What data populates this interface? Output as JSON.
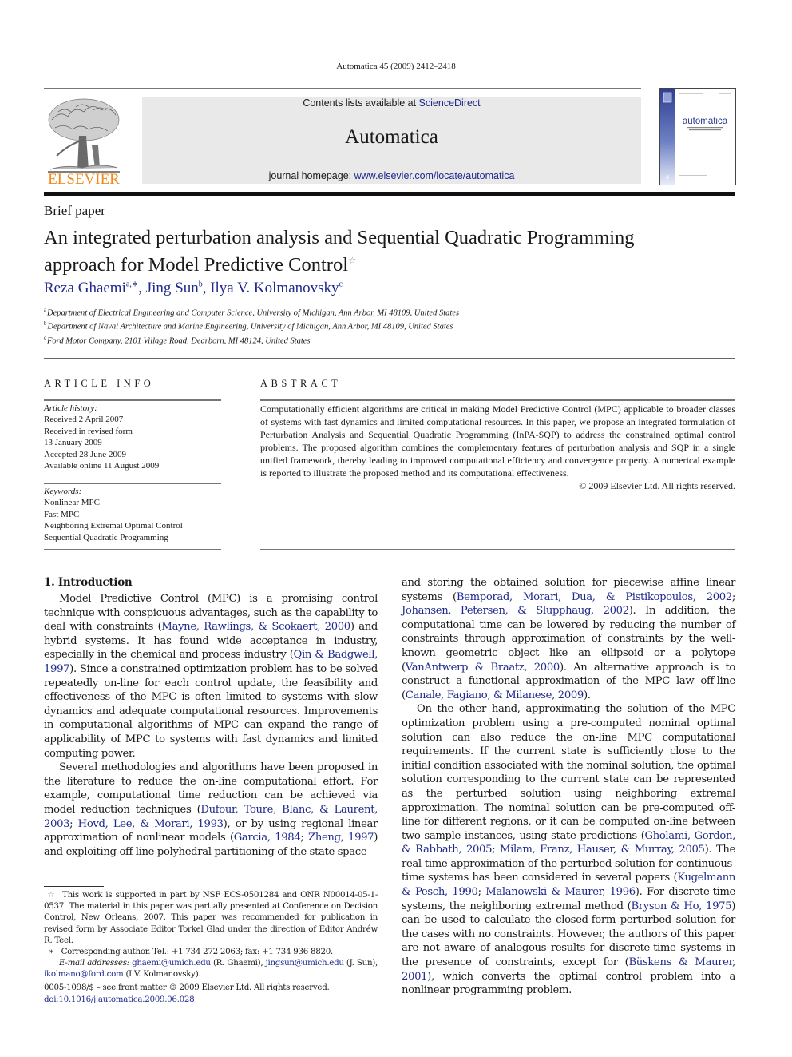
{
  "header": {
    "running_head": "Automatica 45 (2009) 2412–2418",
    "contents_prefix": "Contents lists available at ",
    "contents_link": "ScienceDirect",
    "journal_name": "Automatica",
    "homepage_prefix": "journal homepage: ",
    "homepage_link": "www.elsevier.com/locate/automatica",
    "publisher_logo_text": "ELSEVIER",
    "cover_title": "automatica",
    "colors": {
      "publisher_orange": "#f08a1c",
      "link_blue": "#1f2a8c",
      "masthead_gray": "#e9e9e9",
      "cover_blue": "#3a4fa0"
    }
  },
  "article": {
    "type": "Brief paper",
    "title_line1": "An integrated perturbation analysis and Sequential Quadratic Programming",
    "title_line2": "approach for Model Predictive Control",
    "title_mark": "☆",
    "authors": [
      {
        "name": "Reza Ghaemi",
        "sup": "a,∗"
      },
      {
        "name": "Jing Sun",
        "sup": "b"
      },
      {
        "name": "Ilya V. Kolmanovsky",
        "sup": "c"
      }
    ],
    "affiliations": [
      {
        "key": "a",
        "text": "Department of Electrical Engineering and Computer Science, University of Michigan, Ann Arbor, MI 48109, United States"
      },
      {
        "key": "b",
        "text": "Department of Naval Architecture and Marine Engineering, University of Michigan, Ann Arbor, MI 48109, United States"
      },
      {
        "key": "c",
        "text": "Ford Motor Company, 2101 Village Road, Dearborn, MI 48124, United States"
      }
    ]
  },
  "article_info": {
    "heading": "ARTICLE INFO",
    "history_label": "Article history:",
    "history": [
      "Received 2 April 2007",
      "Received in revised form",
      "13 January 2009",
      "Accepted 28 June 2009",
      "Available online 11 August 2009"
    ],
    "keywords_label": "Keywords:",
    "keywords": [
      "Nonlinear MPC",
      "Fast MPC",
      "Neighboring Extremal Optimal Control",
      "Sequential Quadratic Programming"
    ]
  },
  "abstract": {
    "heading": "ABSTRACT",
    "text": "Computationally efficient algorithms are critical in making Model Predictive Control (MPC) applicable to broader classes of systems with fast dynamics and limited computational resources. In this paper, we propose an integrated formulation of Perturbation Analysis and Sequential Quadratic Programming (InPA-SQP) to address the constrained optimal control problems. The proposed algorithm combines the complementary features of perturbation analysis and SQP in a single unified framework, thereby leading to improved computational efficiency and convergence property. A numerical example is reported to illustrate the proposed method and its computational effectiveness.",
    "copyright": "© 2009 Elsevier Ltd. All rights reserved."
  },
  "body": {
    "section_heading": "1.  Introduction",
    "left_paragraphs": [
      [
        {
          "t": "Model Predictive Control (MPC) is a promising control technique with conspicuous advantages, such as the capability to deal with constraints ("
        },
        {
          "l": "Mayne, Rawlings, & Scokaert, 2000"
        },
        {
          "t": ") and hybrid systems. It has found wide acceptance in industry, especially in the chemical and process industry ("
        },
        {
          "l": "Qin & Badgwell, 1997"
        },
        {
          "t": "). Since a constrained optimization problem has to be solved repeatedly on-line for each control update, the feasibility and effectiveness of the MPC is often limited to systems with slow dynamics and adequate computational resources. Improvements in computational algorithms of MPC can expand the range of applicability of MPC to systems with fast dynamics and limited computing power."
        }
      ],
      [
        {
          "t": "Several methodologies and algorithms have been proposed in the literature to reduce the on-line computational effort. For example, computational time reduction can be achieved via model reduction techniques ("
        },
        {
          "l": "Dufour, Toure, Blanc, & Laurent, 2003"
        },
        {
          "t": "; "
        },
        {
          "l": "Hovd, Lee, & Morari, 1993"
        },
        {
          "t": "), or by using regional linear approximation of nonlinear models ("
        },
        {
          "l": "Garcia, 1984"
        },
        {
          "t": "; "
        },
        {
          "l": "Zheng, 1997"
        },
        {
          "t": ") and exploiting off-line polyhedral partitioning of the state space"
        }
      ]
    ],
    "right_paragraphs": [
      [
        {
          "t": "and storing the obtained solution for piecewise affine linear systems ("
        },
        {
          "l": "Bemporad, Morari, Dua, & Pistikopoulos, 2002"
        },
        {
          "t": "; "
        },
        {
          "l": "Johansen, Petersen, & Slupphaug, 2002"
        },
        {
          "t": "). In addition, the computational time can be lowered by reducing the number of constraints through approximation of constraints by the well-known geometric object like an ellipsoid or a polytope ("
        },
        {
          "l": "VanAntwerp & Braatz, 2000"
        },
        {
          "t": "). An alternative approach is to construct a functional approximation of the MPC law off-line ("
        },
        {
          "l": "Canale, Fagiano, & Milanese, 2009"
        },
        {
          "t": ")."
        }
      ],
      [
        {
          "t": "On the other hand, approximating the solution of the MPC optimization problem using a pre-computed nominal optimal solution can also reduce the on-line MPC computational requirements. If the current state is sufficiently close to the initial condition associated with the nominal solution, the optimal solution corresponding to the current state can be represented as the perturbed solution using neighboring extremal approximation. The nominal solution can be pre-computed off-line for different regions, or it can be computed on-line between two sample instances, using state predictions ("
        },
        {
          "l": "Gholami, Gordon, & Rabbath, 2005"
        },
        {
          "t": "; "
        },
        {
          "l": "Milam, Franz, Hauser, & Murray, 2005"
        },
        {
          "t": "). The real-time approximation of the perturbed solution for continuous-time systems has been considered in several papers ("
        },
        {
          "l": "Kugelmann & Pesch, 1990"
        },
        {
          "t": "; "
        },
        {
          "l": "Malanowski & Maurer, 1996"
        },
        {
          "t": "). For discrete-time systems, the neighboring extremal method ("
        },
        {
          "l": "Bryson & Ho, 1975"
        },
        {
          "t": ") can be used to calculate the closed-form perturbed solution for the cases with no constraints. However, the authors of this paper are not aware of analogous results for discrete-time systems in the presence of constraints, except for ("
        },
        {
          "l": "Büskens & Maurer, 2001"
        },
        {
          "t": "), which converts the optimal control problem into a nonlinear programming problem."
        }
      ]
    ]
  },
  "footnotes": {
    "star_mark": "☆",
    "star_text": "This work is supported in part by NSF ECS-0501284 and ONR N00014-05-1-0537. The material in this paper was partially presented at Conference on Decision Control, New Orleans, 2007. This paper was recommended for publication in revised form by Associate Editor Torkel Glad under the direction of Editor Andréw R. Teel.",
    "corr_mark": "∗",
    "corr_text": "Corresponding author. Tel.: +1 734 272 2063; fax: +1 734 936 8820.",
    "email_label": "E-mail addresses:",
    "emails": [
      {
        "address": "ghaemi@umich.edu",
        "who": " (R. Ghaemi), "
      },
      {
        "address": "jingsun@umich.edu",
        "who": " (J. Sun), "
      },
      {
        "address": "ikolmano@ford.com",
        "who": " (I.V. Kolmanovsky)."
      }
    ]
  },
  "front_matter": {
    "issn_line": "0005-1098/$ – see front matter © 2009 Elsevier Ltd. All rights reserved.",
    "doi": "doi:10.1016/j.automatica.2009.06.028"
  }
}
